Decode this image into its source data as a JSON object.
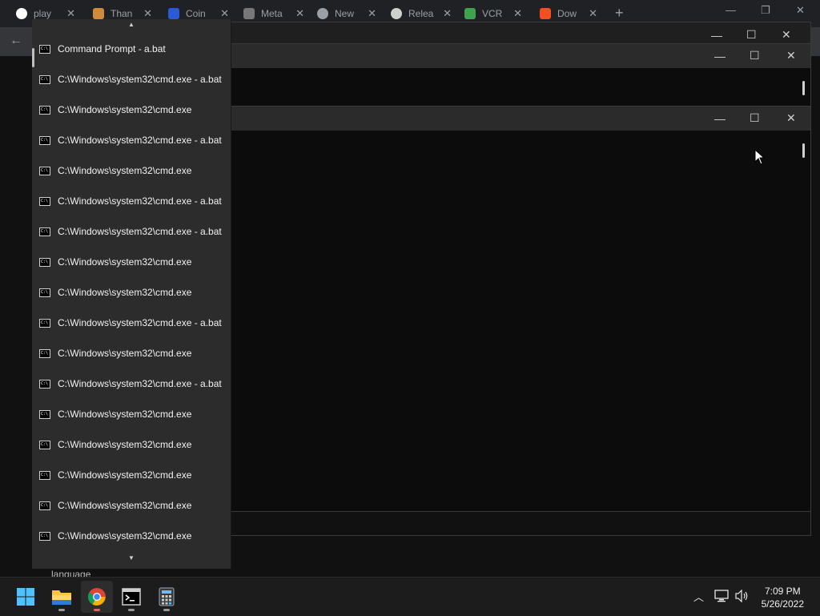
{
  "browser": {
    "tabs": [
      {
        "label": "play",
        "fav_color": "#ffffff"
      },
      {
        "label": "Than",
        "fav_color": "#d08a3c"
      },
      {
        "label": "Coin",
        "fav_color": "#2a5bd7"
      },
      {
        "label": "Meta",
        "fav_color": "#777777"
      },
      {
        "label": "New",
        "fav_color": "#9aa0a6"
      },
      {
        "label": "Relea",
        "fav_color": "#cfcfcf"
      },
      {
        "label": "VCR",
        "fav_color": "#3fa34d"
      },
      {
        "label": "Dow",
        "fav_color": "#f25022"
      }
    ],
    "partial_text": "language"
  },
  "jumplist": {
    "items": [
      "Command Prompt - a.bat",
      "C:\\Windows\\system32\\cmd.exe - a.bat",
      "C:\\Windows\\system32\\cmd.exe",
      "C:\\Windows\\system32\\cmd.exe - a.bat",
      "C:\\Windows\\system32\\cmd.exe",
      "C:\\Windows\\system32\\cmd.exe - a.bat",
      "C:\\Windows\\system32\\cmd.exe - a.bat",
      "C:\\Windows\\system32\\cmd.exe",
      "C:\\Windows\\system32\\cmd.exe",
      "C:\\Windows\\system32\\cmd.exe - a.bat",
      "C:\\Windows\\system32\\cmd.exe",
      "C:\\Windows\\system32\\cmd.exe - a.bat",
      "C:\\Windows\\system32\\cmd.exe",
      "C:\\Windows\\system32\\cmd.exe",
      "C:\\Windows\\system32\\cmd.exe",
      "C:\\Windows\\system32\\cmd.exe",
      "C:\\Windows\\system32\\cmd.exe"
    ]
  },
  "taskbar": {
    "pinned": [
      "start",
      "file-explorer",
      "chrome",
      "command-prompt",
      "calculator"
    ],
    "time": "7:09 PM",
    "date": "5/26/2022"
  },
  "colors": {
    "accent": "#0078d4",
    "jumplist_bg": "#2c2c2c",
    "console_bg": "#0c0c0c"
  }
}
